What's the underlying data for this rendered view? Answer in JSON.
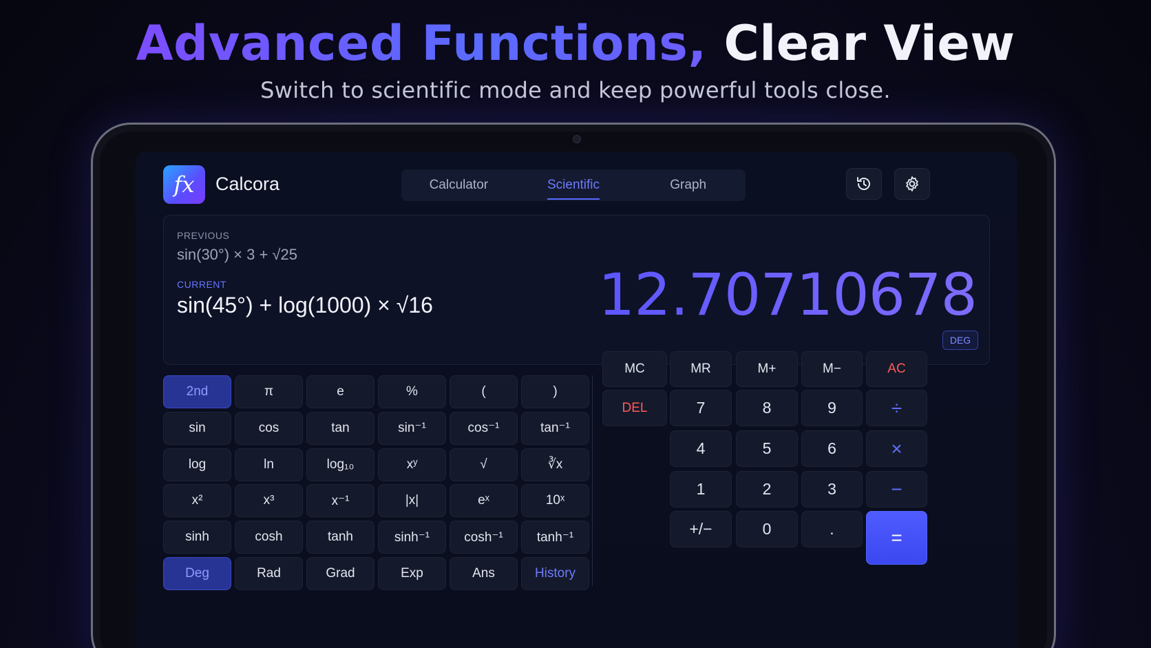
{
  "promo": {
    "headline_part1": "Advanced Functions,",
    "headline_part2": "Clear View",
    "subhead": "Switch to scientific mode and keep powerful tools close."
  },
  "app": {
    "logo_text": "fx",
    "name": "Calcora",
    "tabs": [
      {
        "label": "Calculator",
        "active": false
      },
      {
        "label": "Scientific",
        "active": true
      },
      {
        "label": "Graph",
        "active": false
      }
    ],
    "icons": [
      "history-icon",
      "gear-icon"
    ]
  },
  "display": {
    "previous_label": "PREVIOUS",
    "previous_expression": "sin(30°) × 3 + √25",
    "current_label": "CURRENT",
    "current_expression": "sin(45°) + log(1000) × √16",
    "result": "12.70710678",
    "angle_mode": "DEG"
  },
  "scientific_keys": [
    [
      "2nd",
      "π",
      "e",
      "%",
      "(",
      ")"
    ],
    [
      "sin",
      "cos",
      "tan",
      "sin⁻¹",
      "cos⁻¹",
      "tan⁻¹"
    ],
    [
      "log",
      "ln",
      "log₁₀",
      "xʸ",
      "√",
      "∛x"
    ],
    [
      "x²",
      "x³",
      "x⁻¹",
      "|x|",
      "eˣ",
      "10ˣ"
    ],
    [
      "sinh",
      "cosh",
      "tanh",
      "sinh⁻¹",
      "cosh⁻¹",
      "tanh⁻¹"
    ],
    [
      "Deg",
      "Rad",
      "Grad",
      "Exp",
      "Ans",
      "History"
    ]
  ],
  "selected_keys": [
    "2nd",
    "Deg"
  ],
  "accent_keys": [
    "History"
  ],
  "standard_keys": {
    "row1": [
      "MC",
      "MR",
      "M+",
      "M−",
      "AC"
    ],
    "row2": [
      "DEL",
      "7",
      "8",
      "9",
      "÷"
    ],
    "row3": [
      "4",
      "5",
      "6",
      "×"
    ],
    "row4": [
      "1",
      "2",
      "3",
      "−"
    ],
    "row5": [
      "+/−",
      "0",
      ".",
      "="
    ]
  },
  "colors": {
    "accent": "#5a6cff",
    "danger": "#ff5a5a",
    "equals_button": "#4451f8"
  }
}
